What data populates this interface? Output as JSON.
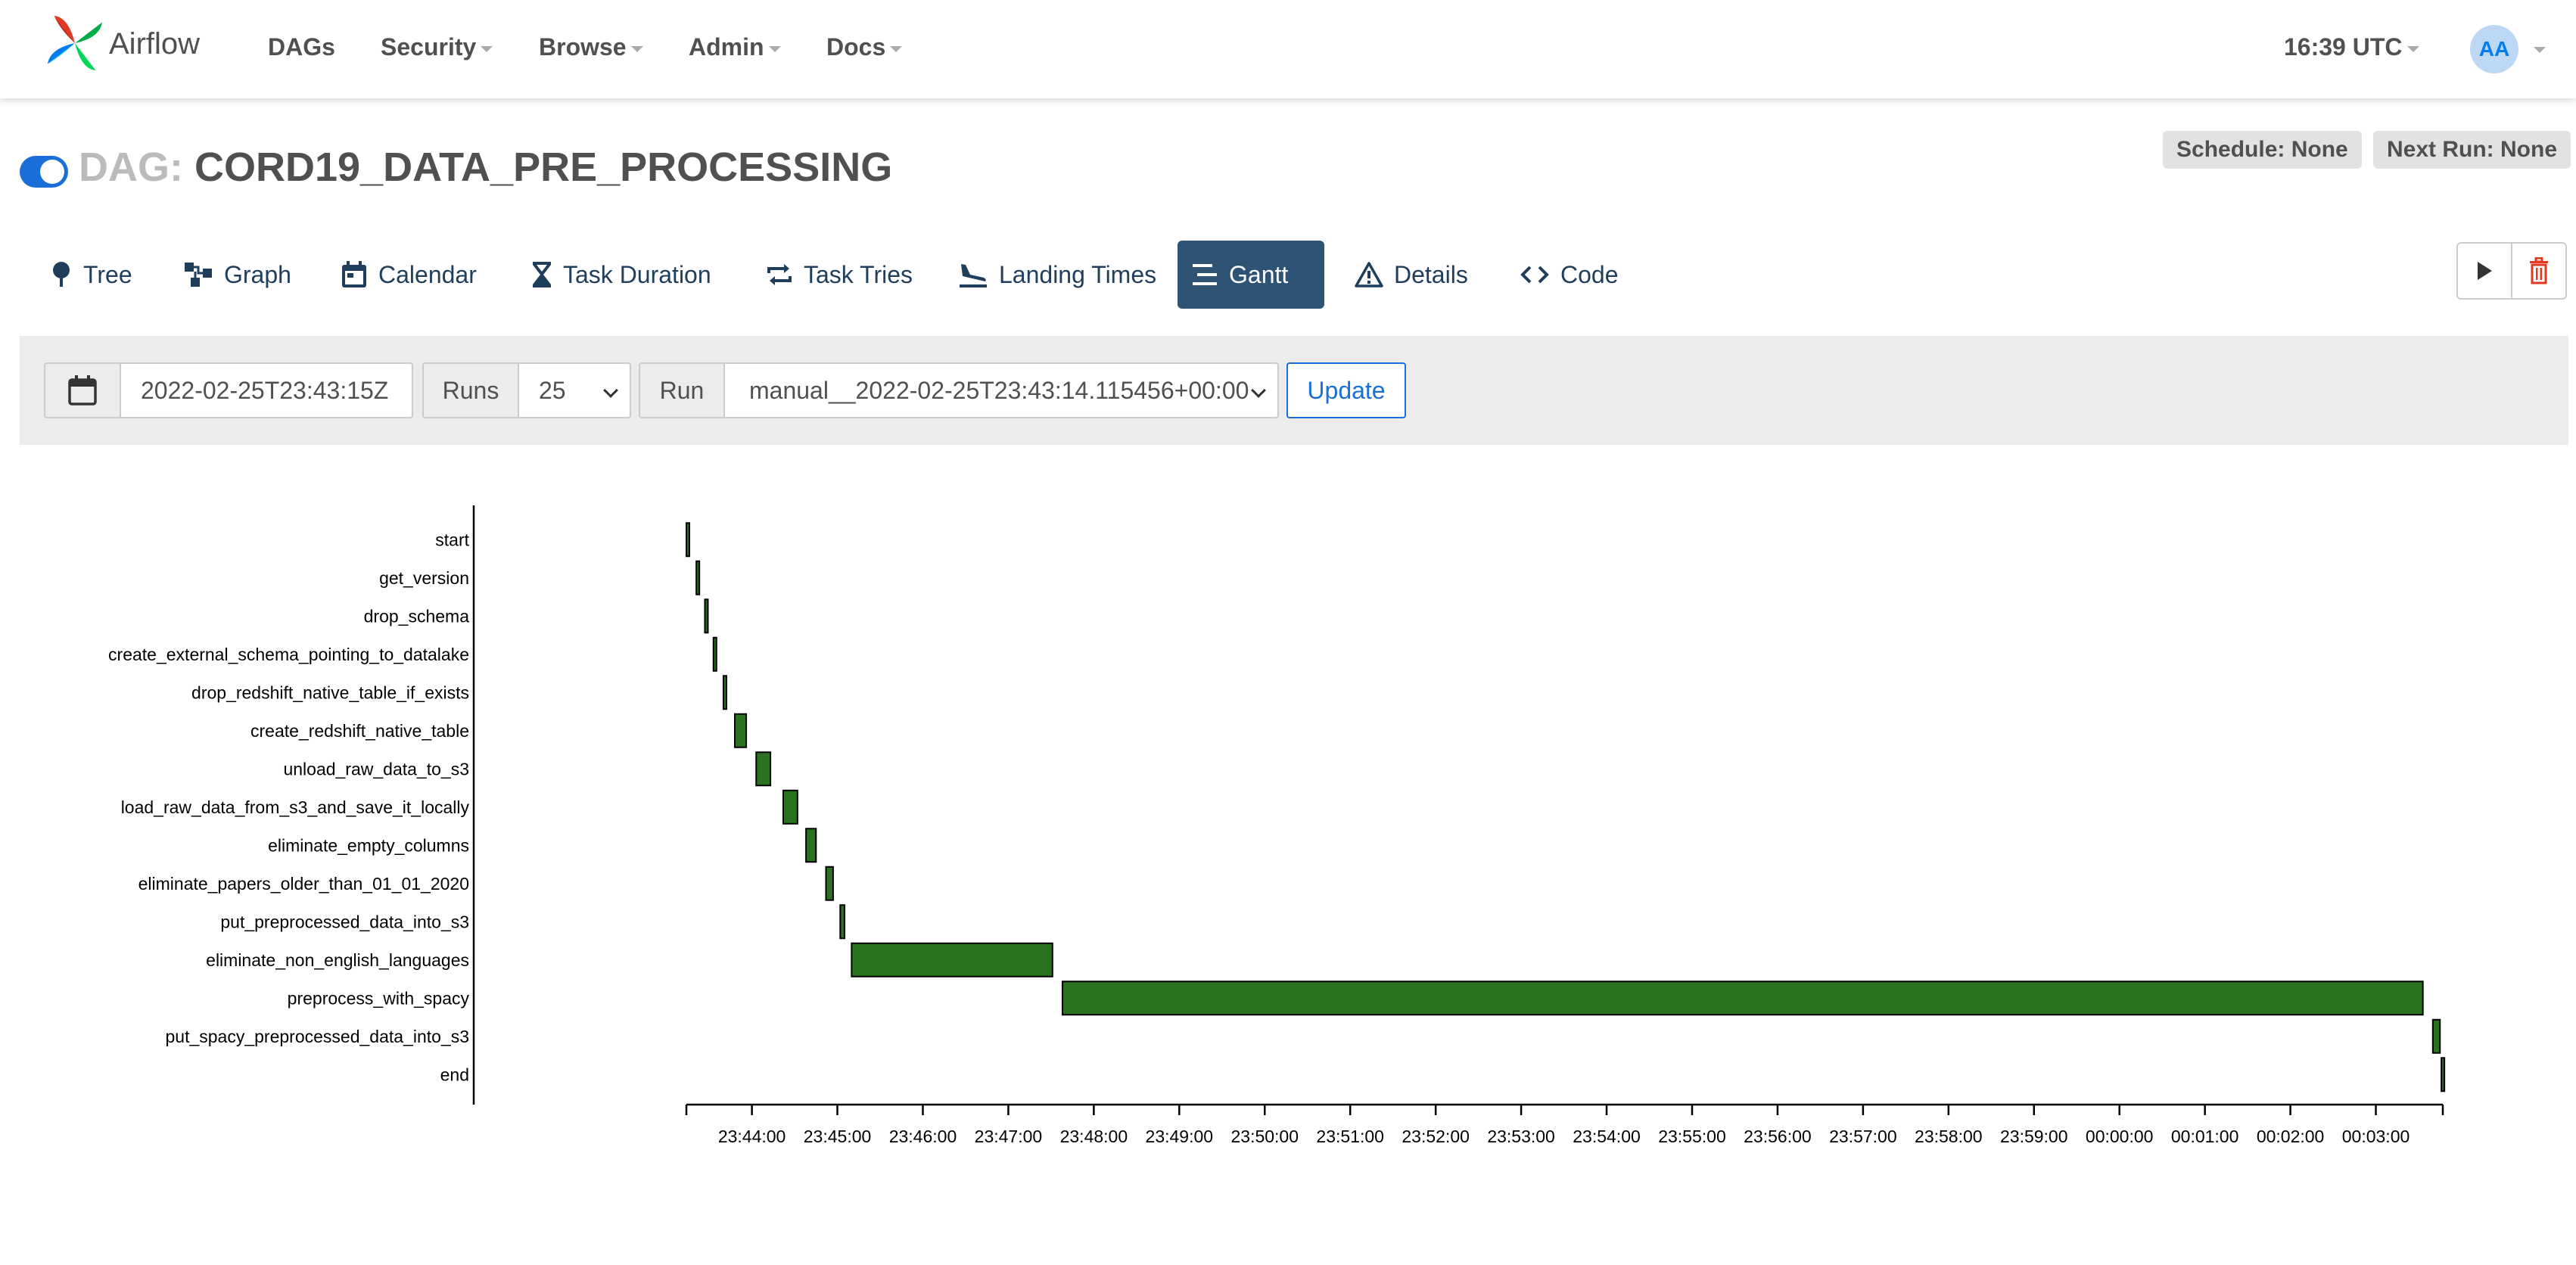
{
  "navbar": {
    "brand": "Airflow",
    "items": [
      {
        "label": "DAGs",
        "dropdown": false
      },
      {
        "label": "Security",
        "dropdown": true
      },
      {
        "label": "Browse",
        "dropdown": true
      },
      {
        "label": "Admin",
        "dropdown": true
      },
      {
        "label": "Docs",
        "dropdown": true
      }
    ],
    "clock": "16:39 UTC",
    "avatar": "AA"
  },
  "dag": {
    "prefix": "DAG:",
    "id": "CORD19_DATA_PRE_PROCESSING",
    "paused": false,
    "schedule": "Schedule: None",
    "next_run": "Next Run: None"
  },
  "tabs": [
    {
      "label": "Tree",
      "icon": "tree-icon"
    },
    {
      "label": "Graph",
      "icon": "graph-icon"
    },
    {
      "label": "Calendar",
      "icon": "calendar-icon"
    },
    {
      "label": "Task Duration",
      "icon": "hourglass-icon"
    },
    {
      "label": "Task Tries",
      "icon": "repeat-icon"
    },
    {
      "label": "Landing Times",
      "icon": "plane-landing-icon"
    },
    {
      "label": "Gantt",
      "icon": "gantt-icon",
      "active": true
    },
    {
      "label": "Details",
      "icon": "warning-icon"
    },
    {
      "label": "Code",
      "icon": "code-icon"
    }
  ],
  "filters": {
    "base_date": "2022-02-25T23:43:15Z",
    "runs_label": "Runs",
    "runs_value": "25",
    "run_label": "Run",
    "run_value": "manual__2022-02-25T23:43:14.115456+00:00",
    "update_label": "Update"
  },
  "colors": {
    "accent": "#017cee",
    "toggle": "#1a6ed8",
    "active_tab": "#2e5375",
    "bar_success": "#2b7220",
    "delete": "#e43921"
  },
  "chart_data": {
    "type": "gantt",
    "x_start": "23:43:14",
    "x_ticks": [
      "23:44:00",
      "23:45:00",
      "23:46:00",
      "23:47:00",
      "23:48:00",
      "23:49:00",
      "23:50:00",
      "23:51:00",
      "23:52:00",
      "23:53:00",
      "23:54:00",
      "23:55:00",
      "23:56:00",
      "23:57:00",
      "23:58:00",
      "23:59:00",
      "00:00:00",
      "00:01:00",
      "00:02:00",
      "00:03:00"
    ],
    "tasks": [
      {
        "name": "start",
        "start": "23:43:14",
        "end": "23:43:15"
      },
      {
        "name": "get_version",
        "start": "23:43:21",
        "end": "23:43:22"
      },
      {
        "name": "drop_schema",
        "start": "23:43:27",
        "end": "23:43:28"
      },
      {
        "name": "create_external_schema_pointing_to_datalake",
        "start": "23:43:33",
        "end": "23:43:34"
      },
      {
        "name": "drop_redshift_native_table_if_exists",
        "start": "23:43:40",
        "end": "23:43:41"
      },
      {
        "name": "create_redshift_native_table",
        "start": "23:43:48",
        "end": "23:43:56"
      },
      {
        "name": "unload_raw_data_to_s3",
        "start": "23:44:03",
        "end": "23:44:13"
      },
      {
        "name": "load_raw_data_from_s3_and_save_it_locally",
        "start": "23:44:22",
        "end": "23:44:32"
      },
      {
        "name": "eliminate_empty_columns",
        "start": "23:44:38",
        "end": "23:44:45"
      },
      {
        "name": "eliminate_papers_older_than_01_01_2020",
        "start": "23:44:52",
        "end": "23:44:57"
      },
      {
        "name": "put_preprocessed_data_into_s3",
        "start": "23:45:02",
        "end": "23:45:05"
      },
      {
        "name": "eliminate_non_english_languages",
        "start": "23:45:10",
        "end": "23:47:31"
      },
      {
        "name": "preprocess_with_spacy",
        "start": "23:47:38",
        "end": "00:03:33"
      },
      {
        "name": "put_spacy_preprocessed_data_into_s3",
        "start": "00:03:40",
        "end": "00:03:45"
      },
      {
        "name": "end",
        "start": "00:03:46",
        "end": "00:03:47"
      }
    ]
  }
}
